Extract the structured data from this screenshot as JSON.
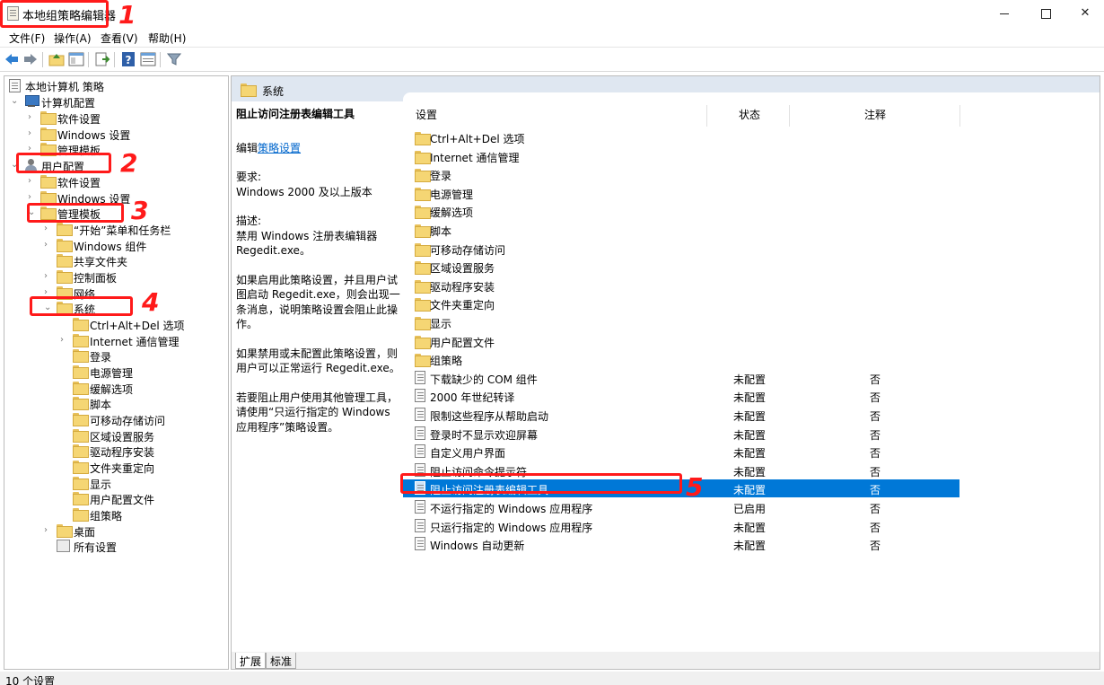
{
  "window": {
    "title": "本地组策略编辑器"
  },
  "menu": [
    "文件(F)",
    "操作(A)",
    "查看(V)",
    "帮助(H)"
  ],
  "tree": {
    "root": "本地计算机 策略",
    "computer_config": "计算机配置",
    "computer_children": [
      "软件设置",
      "Windows 设置",
      "管理模板"
    ],
    "user_config": "用户配置",
    "user_children": [
      "软件设置",
      "Windows 设置",
      "管理模板"
    ],
    "admin_templates_children": [
      "“开始”菜单和任务栏",
      "Windows 组件",
      "共享文件夹",
      "控制面板",
      "网络",
      "系统"
    ],
    "system_children": [
      "Ctrl+Alt+Del 选项",
      "Internet 通信管理",
      "登录",
      "电源管理",
      "缓解选项",
      "脚本",
      "可移动存储访问",
      "区域设置服务",
      "驱动程序安装",
      "文件夹重定向",
      "显示",
      "用户配置文件",
      "组策略"
    ],
    "after_system": [
      "桌面",
      "所有设置"
    ]
  },
  "right_pane": {
    "header_title": "系统",
    "description": {
      "title": "阻止访问注册表编辑工具",
      "edit_prefix": "编辑",
      "edit_link": "策略设置",
      "requirements_label": "要求:",
      "requirements": "Windows 2000 及以上版本",
      "description_label": "描述:",
      "description_text": "禁用 Windows 注册表编辑器 Regedit.exe。",
      "para1": "如果启用此策略设置，并且用户试图启动 Regedit.exe，则会出现一条消息，说明策略设置会阻止此操作。",
      "para2": "如果禁用或未配置此策略设置，则用户可以正常运行 Regedit.exe。",
      "para3": "若要阻止用户使用其他管理工具，请使用“只运行指定的 Windows 应用程序”策略设置。"
    },
    "columns": [
      "设置",
      "状态",
      "注释"
    ],
    "folders": [
      "Ctrl+Alt+Del 选项",
      "Internet 通信管理",
      "登录",
      "电源管理",
      "缓解选项",
      "脚本",
      "可移动存储访问",
      "区域设置服务",
      "驱动程序安装",
      "文件夹重定向",
      "显示",
      "用户配置文件",
      "组策略"
    ],
    "settings": [
      {
        "name": "下载缺少的 COM 组件",
        "state": "未配置",
        "note": "否"
      },
      {
        "name": "2000 年世纪转译",
        "state": "未配置",
        "note": "否"
      },
      {
        "name": "限制这些程序从帮助启动",
        "state": "未配置",
        "note": "否"
      },
      {
        "name": "登录时不显示欢迎屏幕",
        "state": "未配置",
        "note": "否"
      },
      {
        "name": "自定义用户界面",
        "state": "未配置",
        "note": "否"
      },
      {
        "name": "阻止访问命令提示符",
        "state": "未配置",
        "note": "否"
      },
      {
        "name": "阻止访问注册表编辑工具",
        "state": "未配置",
        "note": "否"
      },
      {
        "name": "不运行指定的 Windows 应用程序",
        "state": "已启用",
        "note": "否"
      },
      {
        "name": "只运行指定的 Windows 应用程序",
        "state": "未配置",
        "note": "否"
      },
      {
        "name": "Windows 自动更新",
        "state": "未配置",
        "note": "否"
      }
    ],
    "selected_index": 6,
    "tabs": [
      "扩展",
      "标准"
    ]
  },
  "status": "10 个设置",
  "annotations": [
    "1",
    "2",
    "3",
    "4",
    "5"
  ],
  "colors": {
    "selection": "#0078d7",
    "annotation": "#ff1a1a",
    "folder": "#f5d674"
  }
}
